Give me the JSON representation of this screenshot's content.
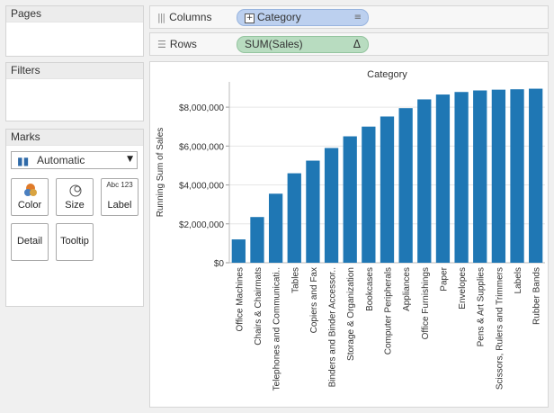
{
  "pages": {
    "title": "Pages"
  },
  "filters": {
    "title": "Filters"
  },
  "marks": {
    "title": "Marks",
    "mark_type": "Automatic",
    "buttons": {
      "color": "Color",
      "size": "Size",
      "label": "Label",
      "label_icon": "Abc 123",
      "detail": "Detail",
      "tooltip": "Tooltip"
    }
  },
  "shelves": {
    "columns": {
      "label": "Columns",
      "pill": "Category"
    },
    "rows": {
      "label": "Rows",
      "pill": "SUM(Sales)"
    }
  },
  "colors": {
    "bar": "#1f77b4",
    "columns_pill": "#bcd0ef",
    "rows_pill": "#b8dcc0"
  },
  "chart_data": {
    "type": "bar",
    "title": "Category",
    "ylabel": "Running Sum of Sales",
    "ylim": [
      0,
      9300000
    ],
    "yticks": [
      0,
      2000000,
      4000000,
      6000000,
      8000000
    ],
    "ytick_labels": [
      "$0",
      "$2,000,000",
      "$4,000,000",
      "$6,000,000",
      "$8,000,000"
    ],
    "categories": [
      "Office Machines",
      "Chairs & Chairmats",
      "Telephones and Communicati..",
      "Tables",
      "Copiers and Fax",
      "Binders and Binder Accessor..",
      "Storage & Organization",
      "Bookcases",
      "Computer Peripherals",
      "Appliances",
      "Office Furnishings",
      "Paper",
      "Envelopes",
      "Pens & Art Supplies",
      "Scissors, Rulers and Trimmers",
      "Labels",
      "Rubber Bands"
    ],
    "values": [
      1200000,
      2350000,
      3550000,
      4600000,
      5250000,
      5900000,
      6500000,
      7000000,
      7520000,
      7950000,
      8400000,
      8650000,
      8780000,
      8860000,
      8900000,
      8920000,
      8950000
    ],
    "grid": "horizontal",
    "legend": "none"
  }
}
